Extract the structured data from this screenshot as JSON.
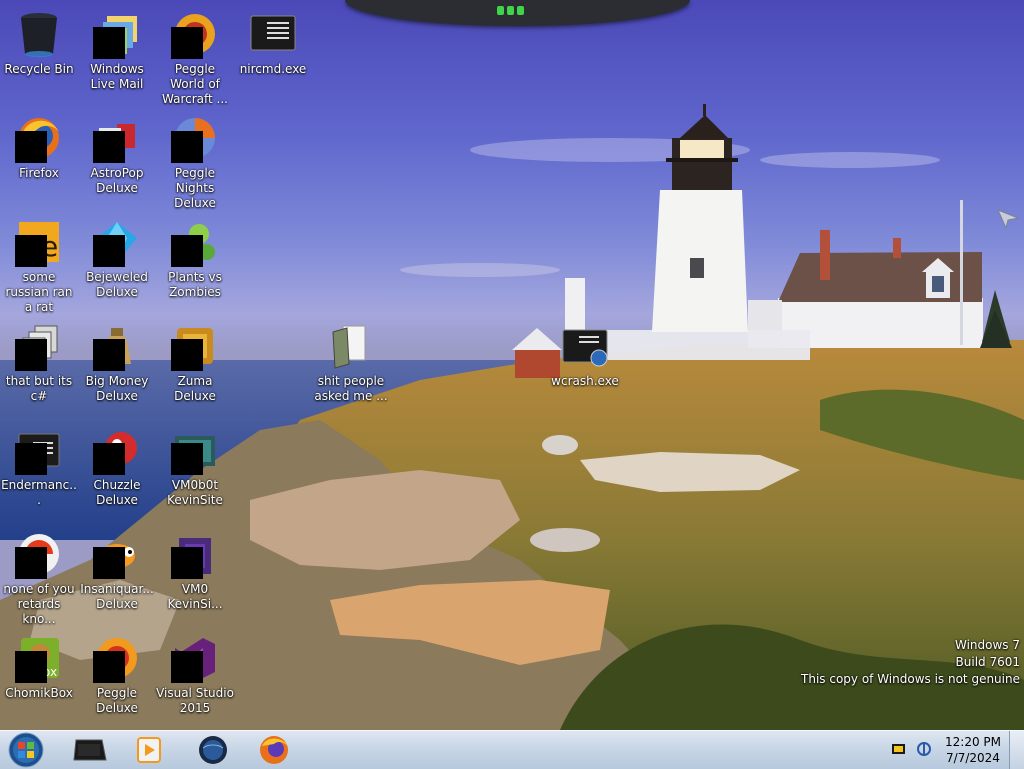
{
  "desktop": {
    "icons": [
      {
        "label": "Recycle Bin",
        "icon": "recycle-bin-icon"
      },
      {
        "label": "Windows Live Mail",
        "icon": "windows-live-mail-icon"
      },
      {
        "label": "Peggle World of Warcraft ...",
        "icon": "peggle-wow-icon"
      },
      {
        "label": "nircmd.exe",
        "icon": "executable-icon"
      },
      {
        "label": "Firefox",
        "icon": "firefox-icon"
      },
      {
        "label": "AstroPop Deluxe",
        "icon": "astropop-icon"
      },
      {
        "label": "Peggle Nights Deluxe",
        "icon": "peggle-nights-icon"
      },
      {
        "label": "some russian ran a rat",
        "icon": "file-icon"
      },
      {
        "label": "Bejeweled Deluxe",
        "icon": "bejeweled-icon"
      },
      {
        "label": "Plants vs Zombies",
        "icon": "plants-vs-zombies-icon"
      },
      {
        "label": "that but its c#",
        "icon": "file-icon"
      },
      {
        "label": "Big Money Deluxe",
        "icon": "big-money-icon"
      },
      {
        "label": "Zuma Deluxe",
        "icon": "zuma-icon"
      },
      {
        "label": "shit people asked me ...",
        "icon": "folder-icon"
      },
      {
        "label": "wcrash.exe",
        "icon": "executable-icon"
      },
      {
        "label": "Endermanc...",
        "icon": "executable-icon"
      },
      {
        "label": "Chuzzle Deluxe",
        "icon": "chuzzle-icon"
      },
      {
        "label": "VM0b0t KevinSite",
        "icon": "vm-icon"
      },
      {
        "label": "none of you retards kno...",
        "icon": "file-icon"
      },
      {
        "label": "Insaniquar... Deluxe",
        "icon": "insaniquarium-icon"
      },
      {
        "label": "VM0 KevinSi...",
        "icon": "vm-icon"
      },
      {
        "label": "ChomikBox",
        "icon": "chomikbox-icon"
      },
      {
        "label": "Peggle Deluxe",
        "icon": "peggle-icon"
      },
      {
        "label": "Visual Studio 2015",
        "icon": "visual-studio-icon"
      }
    ],
    "watermark": {
      "line1": "Windows 7",
      "line2": "Build 7601",
      "line3": "This copy of Windows is not genuine"
    }
  },
  "taskbar": {
    "start_icon": "windows-orb-icon",
    "pinned": [
      {
        "name": "terminal-icon"
      },
      {
        "name": "media-player-icon"
      },
      {
        "name": "globe-icon"
      },
      {
        "name": "firefox-icon"
      }
    ],
    "clock": {
      "time": "12:20 PM",
      "date": "7/7/2024"
    }
  },
  "colors": {
    "taskbar": "#c8d6e6",
    "sky_top": "#4b49b8",
    "label": "#ffffff"
  }
}
